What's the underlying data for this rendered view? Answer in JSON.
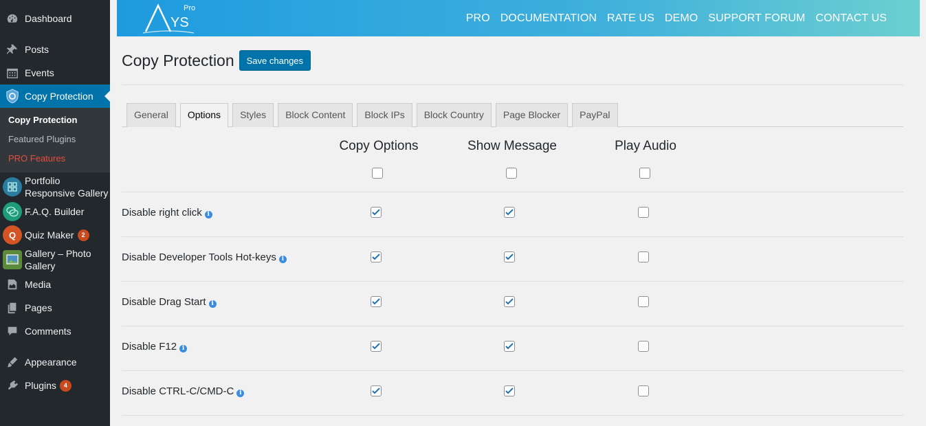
{
  "sidebar": {
    "items": [
      {
        "label": "Dashboard",
        "icon": "dashboard-icon"
      },
      {
        "label": "Posts",
        "icon": "pin-icon"
      },
      {
        "label": "Events",
        "icon": "calendar-icon"
      },
      {
        "label": "Copy Protection",
        "icon": "shield-icon",
        "active": true
      }
    ],
    "submenu": [
      {
        "label": "Copy Protection",
        "current": true
      },
      {
        "label": "Featured Plugins"
      },
      {
        "label": "PRO Features",
        "pro": true
      }
    ],
    "plugins": [
      {
        "label": "Portfolio Responsive Gallery",
        "icon": "portfolio-icon",
        "color": "#2c7ba0"
      },
      {
        "label": "F.A.Q. Builder",
        "icon": "faq-icon",
        "color": "#1e9c7a"
      },
      {
        "label": "Quiz Maker",
        "icon": "quiz-icon",
        "color": "#d35424",
        "badge": "2"
      },
      {
        "label": "Gallery – Photo Gallery",
        "icon": "gallery-icon",
        "color": "#5a8a3a"
      }
    ],
    "bottom": [
      {
        "label": "Media",
        "icon": "media-icon"
      },
      {
        "label": "Pages",
        "icon": "pages-icon"
      },
      {
        "label": "Comments",
        "icon": "comments-icon"
      },
      {
        "label": "Appearance",
        "icon": "appearance-icon"
      },
      {
        "label": "Plugins",
        "icon": "plugins-icon",
        "badge": "4"
      }
    ]
  },
  "banner": {
    "logo_text": "YS",
    "logo_badge": "Pro",
    "nav": [
      "PRO",
      "DOCUMENTATION",
      "RATE US",
      "DEMO",
      "SUPPORT FORUM",
      "CONTACT US"
    ]
  },
  "page": {
    "title": "Copy Protection",
    "save_label": "Save changes"
  },
  "tabs": [
    "General",
    "Options",
    "Styles",
    "Block Content",
    "Block IPs",
    "Block Country",
    "Page Blocker",
    "PayPal"
  ],
  "active_tab": "Options",
  "columns": [
    {
      "label": "Copy Options",
      "all_checked": false
    },
    {
      "label": "Show Message",
      "all_checked": false
    },
    {
      "label": "Play Audio",
      "all_checked": false
    }
  ],
  "options": [
    {
      "label": "Disable right click",
      "copy": true,
      "message": true,
      "audio": false
    },
    {
      "label": "Disable Developer Tools Hot-keys",
      "copy": true,
      "message": true,
      "audio": false
    },
    {
      "label": "Disable Drag Start",
      "copy": true,
      "message": true,
      "audio": false
    },
    {
      "label": "Disable F12",
      "copy": true,
      "message": true,
      "audio": false
    },
    {
      "label": "Disable CTRL-C/CMD-C",
      "copy": true,
      "message": true,
      "audio": false
    }
  ]
}
